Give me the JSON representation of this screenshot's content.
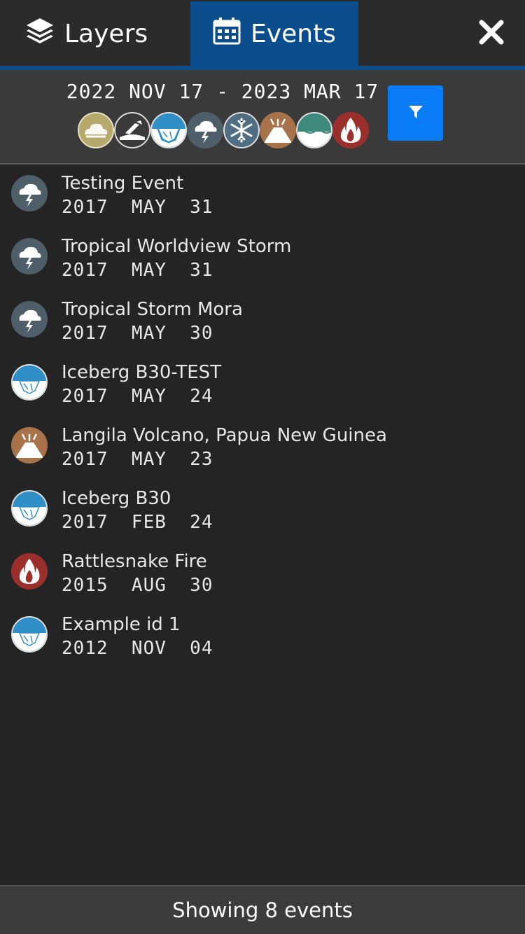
{
  "tabs": {
    "layers": {
      "label": "Layers",
      "icon": "layers-icon"
    },
    "events": {
      "label": "Events",
      "icon": "calendar-icon",
      "active": true
    },
    "close_icon": "close-icon"
  },
  "filter": {
    "date_range": "2022 NOV 17 - 2023 MAR 17",
    "categories": [
      {
        "icon": "dust-haze-icon",
        "color": "#b5a96b"
      },
      {
        "icon": "manmade-icon",
        "color": "#3a3a3a"
      },
      {
        "icon": "sea-lake-ice-icon",
        "color": "#2f8fc6"
      },
      {
        "icon": "severe-storms-icon",
        "color": "#4f5f6a"
      },
      {
        "icon": "snow-icon",
        "color": "#4f6e84"
      },
      {
        "icon": "volcano-icon",
        "color": "#a8724b"
      },
      {
        "icon": "water-color-icon",
        "color": "#3e8a7d"
      },
      {
        "icon": "wildfires-icon",
        "color": "#9b2f2b"
      }
    ],
    "button_icon": "filter-icon",
    "accent": "#0a7cf5"
  },
  "events": [
    {
      "title": "Testing Event",
      "date": "2017  MAY  31",
      "icon": "severe-storms-icon",
      "color": "#4f5f6a"
    },
    {
      "title": "Tropical Worldview Storm",
      "date": "2017  MAY  31",
      "icon": "severe-storms-icon",
      "color": "#4f5f6a"
    },
    {
      "title": "Tropical Storm Mora",
      "date": "2017  MAY  30",
      "icon": "severe-storms-icon",
      "color": "#4f5f6a"
    },
    {
      "title": "Iceberg B30-TEST",
      "date": "2017  MAY  24",
      "icon": "sea-lake-ice-icon",
      "color": "#2f8fc6"
    },
    {
      "title": "Langila Volcano, Papua New Guinea",
      "date": "2017  MAY  23",
      "icon": "volcano-icon",
      "color": "#a8724b"
    },
    {
      "title": "Iceberg B30",
      "date": "2017  FEB  24",
      "icon": "sea-lake-ice-icon",
      "color": "#2f8fc6"
    },
    {
      "title": "Rattlesnake Fire",
      "date": "2015  AUG  30",
      "icon": "wildfires-icon",
      "color": "#9b2f2b"
    },
    {
      "title": "Example id 1",
      "date": "2012  NOV  04",
      "icon": "sea-lake-ice-icon",
      "color": "#2f8fc6"
    }
  ],
  "footer": {
    "text": "Showing 8 events"
  }
}
